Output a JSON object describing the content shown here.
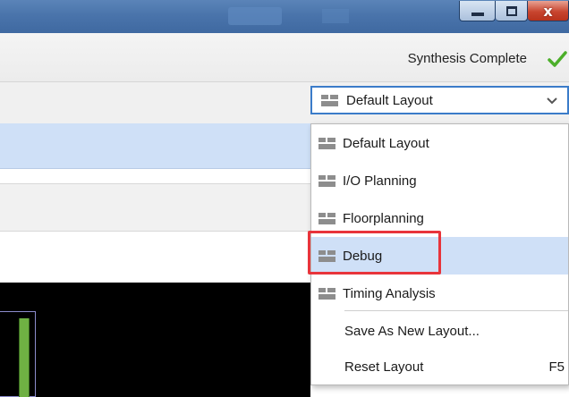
{
  "window": {
    "minimize_glyph": "",
    "maximize_glyph": "",
    "close_glyph": "x"
  },
  "status": {
    "text": "Synthesis Complete",
    "icon": "check-icon",
    "color": "#4caf2a"
  },
  "layout_selector": {
    "selected": "Default Layout",
    "icon": "layout-icon"
  },
  "layout_menu": {
    "items": [
      {
        "label": "Default Layout",
        "icon": "layout-icon"
      },
      {
        "label": "I/O Planning",
        "icon": "layout-icon"
      },
      {
        "label": "Floorplanning",
        "icon": "layout-icon"
      },
      {
        "label": "Debug",
        "icon": "layout-icon",
        "highlighted": true
      },
      {
        "label": "Timing Analysis",
        "icon": "layout-icon"
      }
    ],
    "actions": [
      {
        "label": "Save As New Layout...",
        "shortcut": ""
      },
      {
        "label": "Reset Layout",
        "shortcut": "F5"
      }
    ]
  },
  "colors": {
    "accent": "#3b7cc9",
    "highlight_annotation": "#e8343b",
    "selection": "#cfe0f7"
  }
}
